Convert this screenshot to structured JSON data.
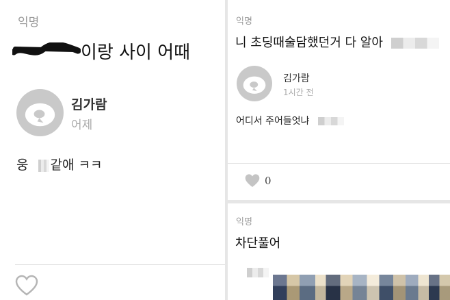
{
  "left_post": {
    "anon_label": "익명",
    "title_suffix": "이랑 사이 어때",
    "comment": {
      "author": "김가람",
      "time": "어제",
      "text_before": "웅",
      "text_after": "같애 ㅋㅋ"
    }
  },
  "right_top_post": {
    "anon_label": "익명",
    "title": "니 초딩때술담했던거 다 알아",
    "comment": {
      "author": "김가람",
      "time": "1시간 전",
      "text": "어디서 주어들엇냐"
    },
    "like_count": "0"
  },
  "right_bottom_post": {
    "anon_label": "익명",
    "title": "차단풀어"
  },
  "icons": {
    "avatar": "panda-avatar-icon",
    "like": "heart-outline-icon"
  },
  "colors": {
    "muted_text": "#999999",
    "avatar_bg": "#c9c9c9",
    "background": "#ffffff"
  }
}
